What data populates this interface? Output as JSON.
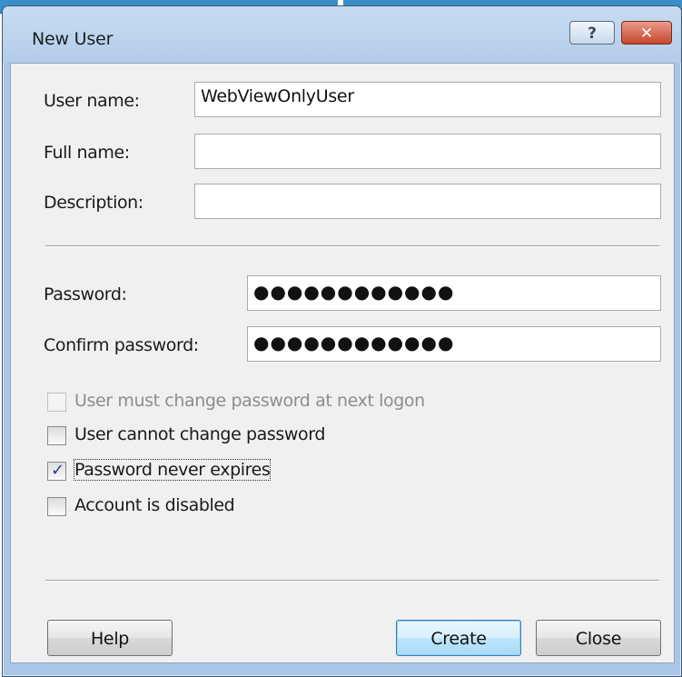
{
  "dialog": {
    "title": "New User",
    "help_glyph": "?",
    "close_glyph": "✕"
  },
  "fields": {
    "user_name": {
      "label": "User name:",
      "value": "WebViewOnlyUser"
    },
    "full_name": {
      "label": "Full name:",
      "value": ""
    },
    "description": {
      "label": "Description:",
      "value": ""
    },
    "password": {
      "label": "Password:",
      "value": "●●●●●●●●●●●●"
    },
    "confirm_password": {
      "label": "Confirm password:",
      "value": "●●●●●●●●●●●●"
    }
  },
  "options": {
    "must_change": {
      "label": "User must change password at next logon",
      "checked": false,
      "enabled": false
    },
    "cannot_change": {
      "label": "User cannot change password",
      "checked": false,
      "enabled": true
    },
    "never_expires": {
      "label": "Password never expires",
      "checked": true,
      "enabled": true
    },
    "disabled": {
      "label": "Account is disabled",
      "checked": false,
      "enabled": true
    }
  },
  "buttons": {
    "help": "Help",
    "create": "Create",
    "close": "Close"
  },
  "colors": {
    "frame": "#a9c6e6",
    "close_button": "#c6452d",
    "default_button": "#3c7fb1"
  }
}
